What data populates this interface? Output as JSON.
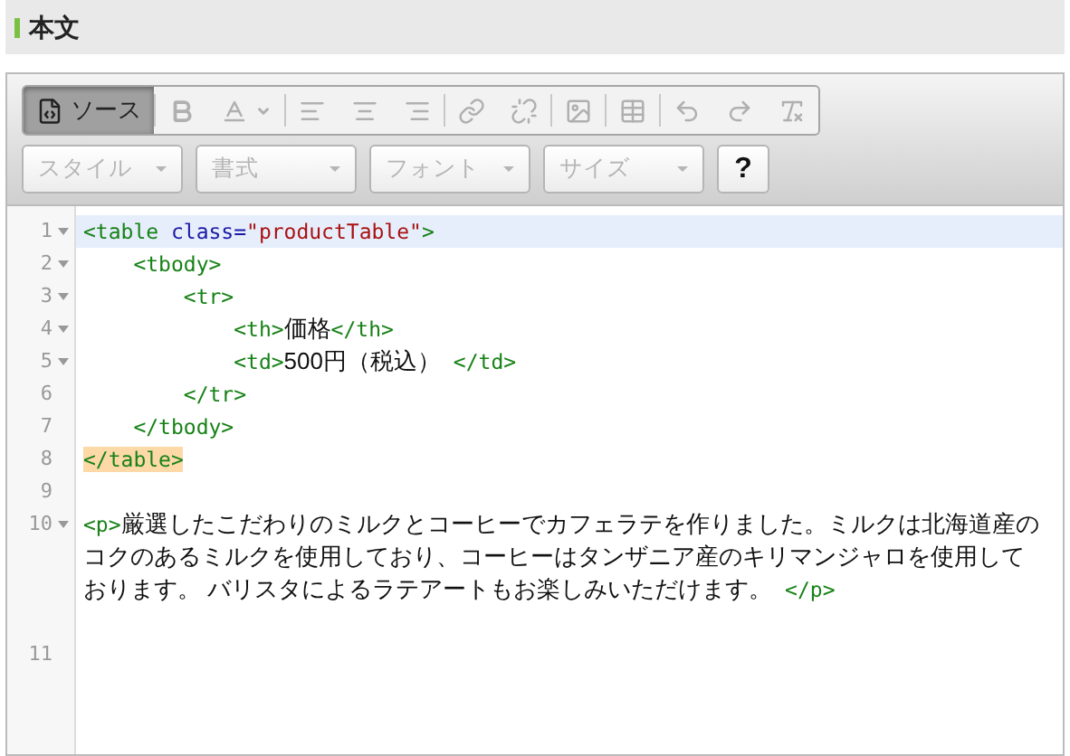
{
  "section": {
    "title": "本文"
  },
  "toolbar": {
    "buttons": [
      {
        "kind": "source",
        "label": "ソース",
        "selected": true,
        "disabled": false,
        "separator_before": false
      },
      {
        "kind": "bold",
        "selected": false,
        "disabled": true,
        "separator_before": true
      },
      {
        "kind": "text-color",
        "selected": false,
        "disabled": true,
        "separator_before": false
      },
      {
        "kind": "align-left",
        "selected": false,
        "disabled": true,
        "separator_before": true
      },
      {
        "kind": "align-center",
        "selected": false,
        "disabled": true,
        "separator_before": false
      },
      {
        "kind": "align-right",
        "selected": false,
        "disabled": true,
        "separator_before": false
      },
      {
        "kind": "link",
        "selected": false,
        "disabled": true,
        "separator_before": true
      },
      {
        "kind": "unlink",
        "selected": false,
        "disabled": true,
        "separator_before": false
      },
      {
        "kind": "image",
        "selected": false,
        "disabled": true,
        "separator_before": true
      },
      {
        "kind": "table",
        "selected": false,
        "disabled": true,
        "separator_before": true
      },
      {
        "kind": "undo",
        "selected": false,
        "disabled": true,
        "separator_before": true
      },
      {
        "kind": "redo",
        "selected": false,
        "disabled": true,
        "separator_before": false
      },
      {
        "kind": "remove-format",
        "selected": false,
        "disabled": true,
        "separator_before": false
      }
    ],
    "dropdowns": [
      {
        "label": "スタイル",
        "disabled": true
      },
      {
        "label": "書式",
        "disabled": true
      },
      {
        "label": "フォント",
        "disabled": true
      },
      {
        "label": "サイズ",
        "disabled": true
      }
    ],
    "help": {
      "label": "?"
    }
  },
  "code": {
    "lines": [
      {
        "number": "1",
        "foldable": true,
        "active": true,
        "tokens": [
          {
            "kind": "tag",
            "text": "<table"
          },
          {
            "kind": "attr",
            "text": " class="
          },
          {
            "kind": "string",
            "text": "\"productTable\""
          },
          {
            "kind": "tag",
            "text": ">"
          }
        ]
      },
      {
        "number": "2",
        "foldable": true,
        "active": false,
        "tokens": [
          {
            "kind": "tag",
            "text": "    <tbody>"
          }
        ]
      },
      {
        "number": "3",
        "foldable": true,
        "active": false,
        "tokens": [
          {
            "kind": "tag",
            "text": "        <tr>"
          }
        ]
      },
      {
        "number": "4",
        "foldable": true,
        "active": false,
        "tokens": [
          {
            "kind": "tag",
            "text": "            <th>"
          },
          {
            "kind": "text",
            "text": "価格"
          },
          {
            "kind": "tag",
            "text": "</th>"
          }
        ]
      },
      {
        "number": "5",
        "foldable": true,
        "active": false,
        "tokens": [
          {
            "kind": "tag",
            "text": "            <td>"
          },
          {
            "kind": "text",
            "text": "500円（税込）"
          },
          {
            "kind": "tag",
            "text": " </td>"
          }
        ]
      },
      {
        "number": "6",
        "foldable": false,
        "active": false,
        "tokens": [
          {
            "kind": "tag",
            "text": "        </tr>"
          }
        ]
      },
      {
        "number": "7",
        "foldable": false,
        "active": false,
        "tokens": [
          {
            "kind": "tag",
            "text": "    </tbody>"
          }
        ]
      },
      {
        "number": "8",
        "foldable": false,
        "active": false,
        "tokens": [
          {
            "kind": "matched-tag",
            "text": "</table>"
          }
        ]
      },
      {
        "number": "9",
        "foldable": false,
        "active": false
      },
      {
        "number": "10",
        "foldable": true,
        "active": false,
        "tokens": [
          {
            "kind": "tag",
            "text": "<p>"
          },
          {
            "kind": "text",
            "text": "厳選したこだわりのミルクとコーヒーでカフェラテを作りました。ミルクは北海道産のコクのあるミルクを使用しており、コーヒーはタンザニア産のキリマンジャロを使用しております。 バリスタによるラテアートもお楽しみいただけます。"
          },
          {
            "kind": "tag",
            "text": " </p>"
          }
        ]
      },
      {
        "number": "11",
        "foldable": false,
        "active": false
      }
    ]
  }
}
